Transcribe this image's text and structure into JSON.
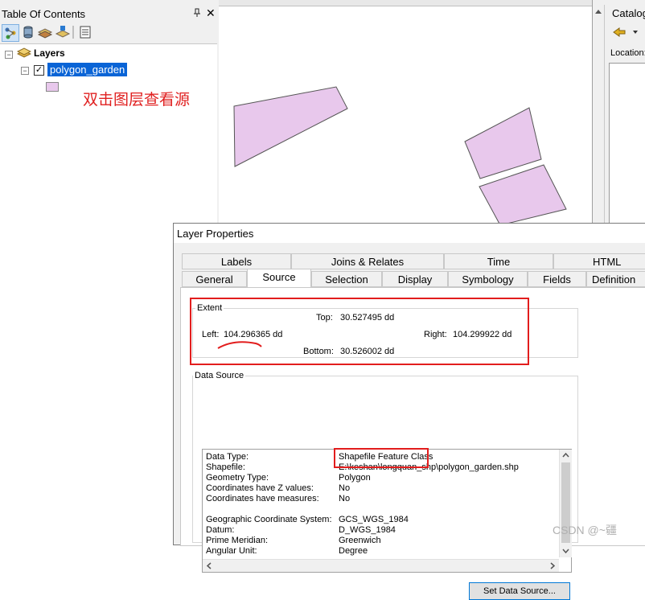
{
  "toc": {
    "title": "Table Of Contents",
    "pin_glyph": "ᴪ",
    "close_glyph": "✕",
    "toolbar_icons": [
      "list-by-drawing-order-icon",
      "list-by-source-icon",
      "list-by-visibility-icon",
      "list-by-selection-icon",
      "options-icon"
    ],
    "root_label": "Layers",
    "layer_name": "polygon_garden",
    "layer_checked": true,
    "layer_fill_color": "#e8c8ec",
    "annotation": "双击图层查看源"
  },
  "catalog": {
    "title": "Catalog",
    "location_label": "Location:"
  },
  "dialog": {
    "title": "Layer Properties",
    "tabs_row1": [
      "Labels",
      "Joins & Relates",
      "Time",
      "HTML Popup"
    ],
    "tabs_row2": [
      "General",
      "Source",
      "Selection",
      "Display",
      "Symbology",
      "Fields",
      "Definition"
    ],
    "active_tab": "Source",
    "extent": {
      "legend": "Extent",
      "top_label": "Top:",
      "top_value": "30.527495 dd",
      "left_label": "Left:",
      "left_value": "104.296365 dd",
      "right_label": "Right:",
      "right_value": "104.299922 dd",
      "bottom_label": "Bottom:",
      "bottom_value": "30.526002 dd"
    },
    "data_source": {
      "legend": "Data Source",
      "rows": [
        {
          "key": "Data Type:",
          "value": "Shapefile Feature Class"
        },
        {
          "key": "Shapefile:",
          "value": "E:\\keshan\\longquan_shp\\polygon_garden.shp"
        },
        {
          "key": "Geometry Type:",
          "value": "Polygon"
        },
        {
          "key": "Coordinates have Z values:",
          "value": "No"
        },
        {
          "key": "Coordinates have measures:",
          "value": "No"
        },
        {
          "key": "",
          "value": ""
        },
        {
          "key": "Geographic Coordinate System:",
          "value": "GCS_WGS_1984"
        },
        {
          "key": "Datum:",
          "value": "D_WGS_1984"
        },
        {
          "key": "Prime Meridian:",
          "value": "Greenwich"
        },
        {
          "key": "Angular Unit:",
          "value": "Degree"
        }
      ]
    },
    "set_button": "Set Data Source..."
  },
  "watermark": "CSDN @~疆",
  "colors": {
    "highlight_red": "#e21d1d",
    "selection_blue": "#0a64d6",
    "polygon_fill": "#e8c8ec"
  }
}
